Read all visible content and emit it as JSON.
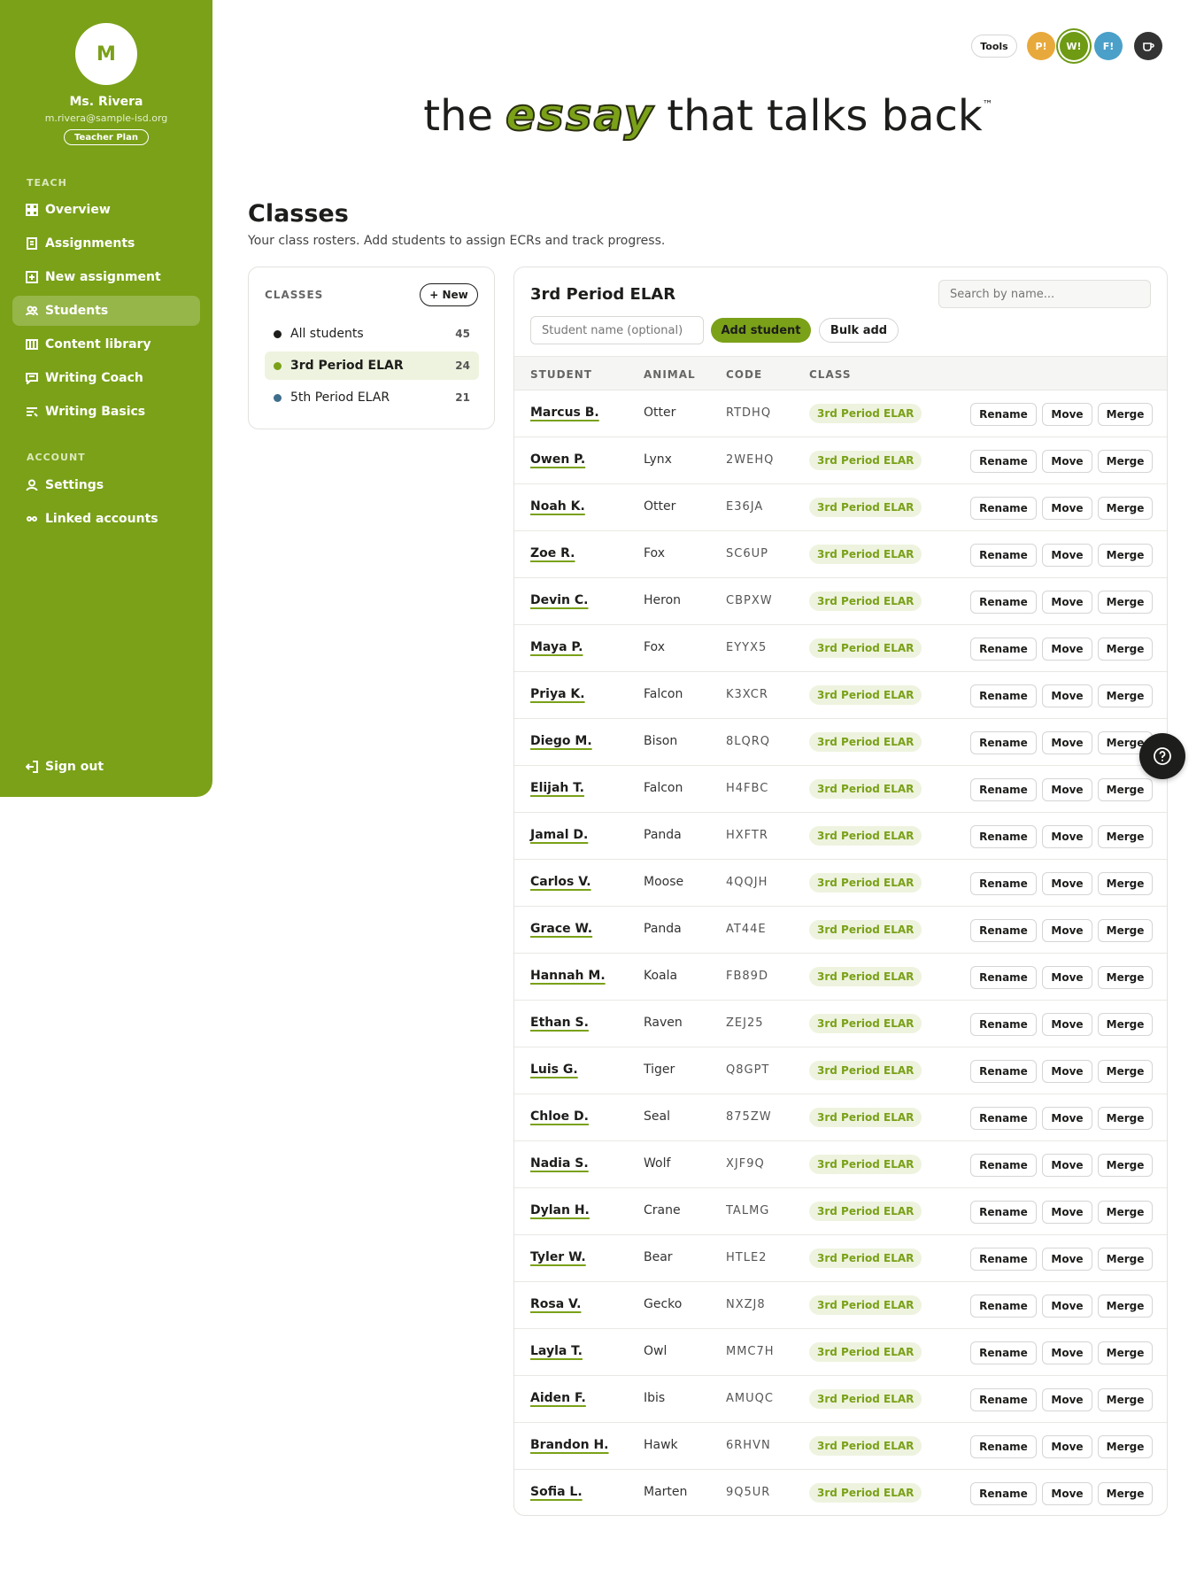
{
  "user": {
    "initial": "M",
    "name": "Ms. Rivera",
    "email": "m.rivera@sample-isd.org",
    "plan": "Teacher Plan"
  },
  "sidebar": {
    "teach_label": "TEACH",
    "account_label": "ACCOUNT",
    "items": [
      {
        "label": "Overview",
        "icon": "grid-icon"
      },
      {
        "label": "Assignments",
        "icon": "document-icon"
      },
      {
        "label": "New assignment",
        "icon": "plus-square-icon"
      },
      {
        "label": "Students",
        "icon": "users-icon",
        "active": true
      },
      {
        "label": "Content library",
        "icon": "library-icon"
      },
      {
        "label": "Writing Coach",
        "icon": "chat-icon"
      },
      {
        "label": "Writing Basics",
        "icon": "list-icon"
      }
    ],
    "account_items": [
      {
        "label": "Settings",
        "icon": "person-icon"
      },
      {
        "label": "Linked accounts",
        "icon": "link-icon"
      }
    ],
    "signout": "Sign out"
  },
  "toolbar": {
    "tools": "Tools",
    "p": "P!",
    "w": "W!",
    "f": "F!"
  },
  "hero": {
    "before": "the",
    "brand": "essay",
    "after": "that talks back",
    "tm": "™"
  },
  "page": {
    "title": "Classes",
    "subtitle": "Your class rosters. Add students to assign ECRs and track progress."
  },
  "classes": {
    "label": "CLASSES",
    "new_button": "+ New",
    "list": [
      {
        "name": "All students",
        "count": "45",
        "color": "#1d1d1b"
      },
      {
        "name": "3rd Period ELAR",
        "count": "24",
        "color": "#7aa118"
      },
      {
        "name": "5th Period ELAR",
        "count": "21",
        "color": "#3f6e8c"
      }
    ]
  },
  "roster": {
    "title": "3rd Period ELAR",
    "search_placeholder": "Search by name...",
    "student_placeholder": "Student name (optional)",
    "add_button": "Add student",
    "bulk_button": "Bulk add",
    "headers": {
      "student": "STUDENT",
      "animal": "ANIMAL",
      "code": "CODE",
      "class": "CLASS"
    },
    "actions": {
      "rename": "Rename",
      "move": "Move",
      "merge": "Merge"
    },
    "students": [
      {
        "name": "Marcus B.",
        "animal": "Otter",
        "code": "RTDHQ",
        "class": "3rd Period ELAR"
      },
      {
        "name": "Owen P.",
        "animal": "Lynx",
        "code": "2WEHQ",
        "class": "3rd Period ELAR"
      },
      {
        "name": "Noah K.",
        "animal": "Otter",
        "code": "E36JA",
        "class": "3rd Period ELAR"
      },
      {
        "name": "Zoe R.",
        "animal": "Fox",
        "code": "SC6UP",
        "class": "3rd Period ELAR"
      },
      {
        "name": "Devin C.",
        "animal": "Heron",
        "code": "CBPXW",
        "class": "3rd Period ELAR"
      },
      {
        "name": "Maya P.",
        "animal": "Fox",
        "code": "EYYX5",
        "class": "3rd Period ELAR"
      },
      {
        "name": "Priya K.",
        "animal": "Falcon",
        "code": "K3XCR",
        "class": "3rd Period ELAR"
      },
      {
        "name": "Diego M.",
        "animal": "Bison",
        "code": "8LQRQ",
        "class": "3rd Period ELAR"
      },
      {
        "name": "Elijah T.",
        "animal": "Falcon",
        "code": "H4FBC",
        "class": "3rd Period ELAR"
      },
      {
        "name": "Jamal D.",
        "animal": "Panda",
        "code": "HXFTR",
        "class": "3rd Period ELAR"
      },
      {
        "name": "Carlos V.",
        "animal": "Moose",
        "code": "4QQJH",
        "class": "3rd Period ELAR"
      },
      {
        "name": "Grace W.",
        "animal": "Panda",
        "code": "AT44E",
        "class": "3rd Period ELAR"
      },
      {
        "name": "Hannah M.",
        "animal": "Koala",
        "code": "FB89D",
        "class": "3rd Period ELAR"
      },
      {
        "name": "Ethan S.",
        "animal": "Raven",
        "code": "ZEJ25",
        "class": "3rd Period ELAR"
      },
      {
        "name": "Luis G.",
        "animal": "Tiger",
        "code": "Q8GPT",
        "class": "3rd Period ELAR"
      },
      {
        "name": "Chloe D.",
        "animal": "Seal",
        "code": "875ZW",
        "class": "3rd Period ELAR"
      },
      {
        "name": "Nadia S.",
        "animal": "Wolf",
        "code": "XJF9Q",
        "class": "3rd Period ELAR"
      },
      {
        "name": "Dylan H.",
        "animal": "Crane",
        "code": "TALMG",
        "class": "3rd Period ELAR"
      },
      {
        "name": "Tyler W.",
        "animal": "Bear",
        "code": "HTLE2",
        "class": "3rd Period ELAR"
      },
      {
        "name": "Rosa V.",
        "animal": "Gecko",
        "code": "NXZJ8",
        "class": "3rd Period ELAR"
      },
      {
        "name": "Layla T.",
        "animal": "Owl",
        "code": "MMC7H",
        "class": "3rd Period ELAR"
      },
      {
        "name": "Aiden F.",
        "animal": "Ibis",
        "code": "AMUQC",
        "class": "3rd Period ELAR"
      },
      {
        "name": "Brandon H.",
        "animal": "Hawk",
        "code": "6RHVN",
        "class": "3rd Period ELAR"
      },
      {
        "name": "Sofia L.",
        "animal": "Marten",
        "code": "9Q5UR",
        "class": "3rd Period ELAR"
      }
    ]
  },
  "colors": {
    "accent": "#7aa118",
    "p": "#e8a93c",
    "w": "#6e9a14",
    "f": "#4aa0c9"
  }
}
